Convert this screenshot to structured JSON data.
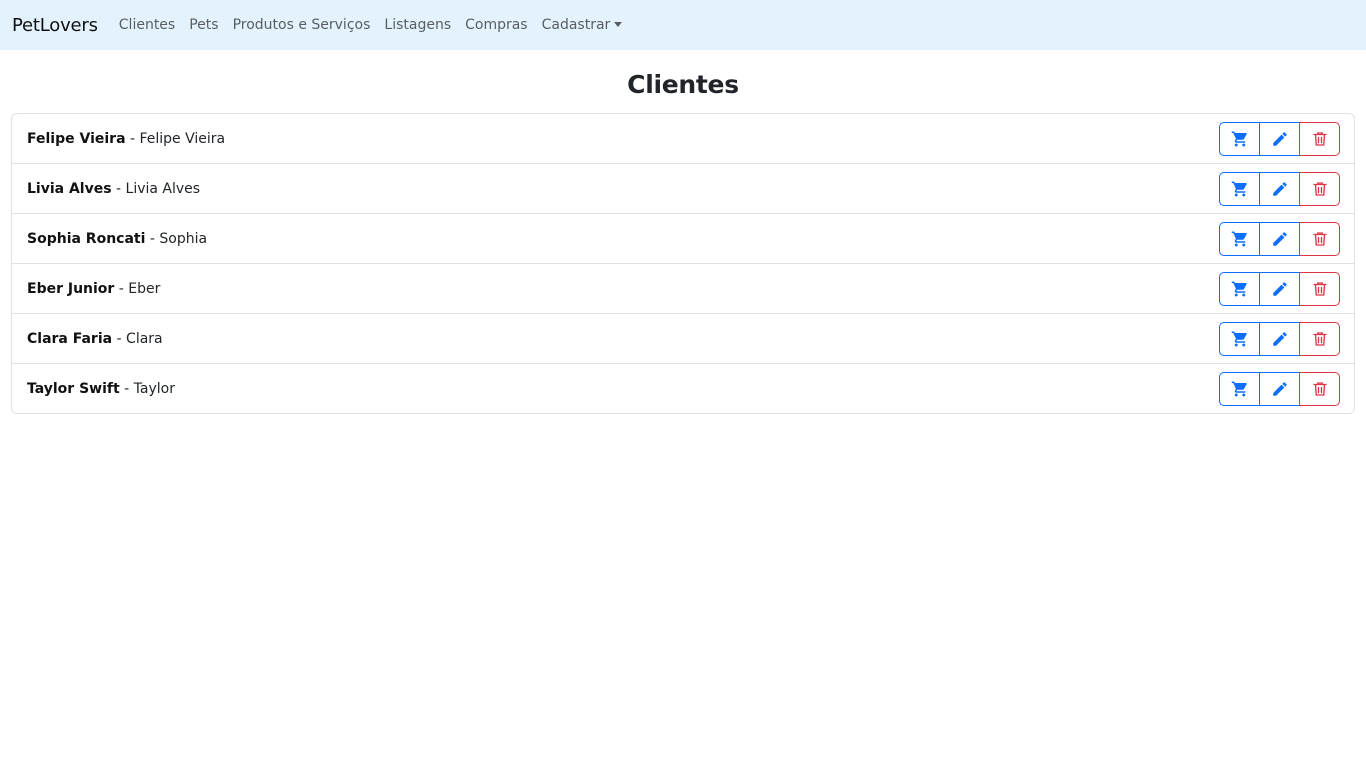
{
  "navbar": {
    "brand": "PetLovers",
    "links": [
      "Clientes",
      "Pets",
      "Produtos e Serviços",
      "Listagens",
      "Compras"
    ],
    "dropdown_label": "Cadastrar"
  },
  "page": {
    "title": "Clientes"
  },
  "clients": [
    {
      "name": "Felipe Vieira",
      "separator": " - ",
      "social_name": "Felipe Vieira"
    },
    {
      "name": "Livia Alves",
      "separator": " - ",
      "social_name": "Livia Alves"
    },
    {
      "name": "Sophia Roncati",
      "separator": " - ",
      "social_name": "Sophia"
    },
    {
      "name": "Eber Junior",
      "separator": " - ",
      "social_name": "Eber"
    },
    {
      "name": "Clara Faria",
      "separator": " - ",
      "social_name": "Clara"
    },
    {
      "name": "Taylor Swift",
      "separator": " - ",
      "social_name": "Taylor"
    }
  ],
  "actions": {
    "icons": [
      "cart-icon",
      "pencil-icon",
      "trash-icon"
    ],
    "primary_color": "#0d6efd",
    "danger_color": "#dc3545"
  }
}
